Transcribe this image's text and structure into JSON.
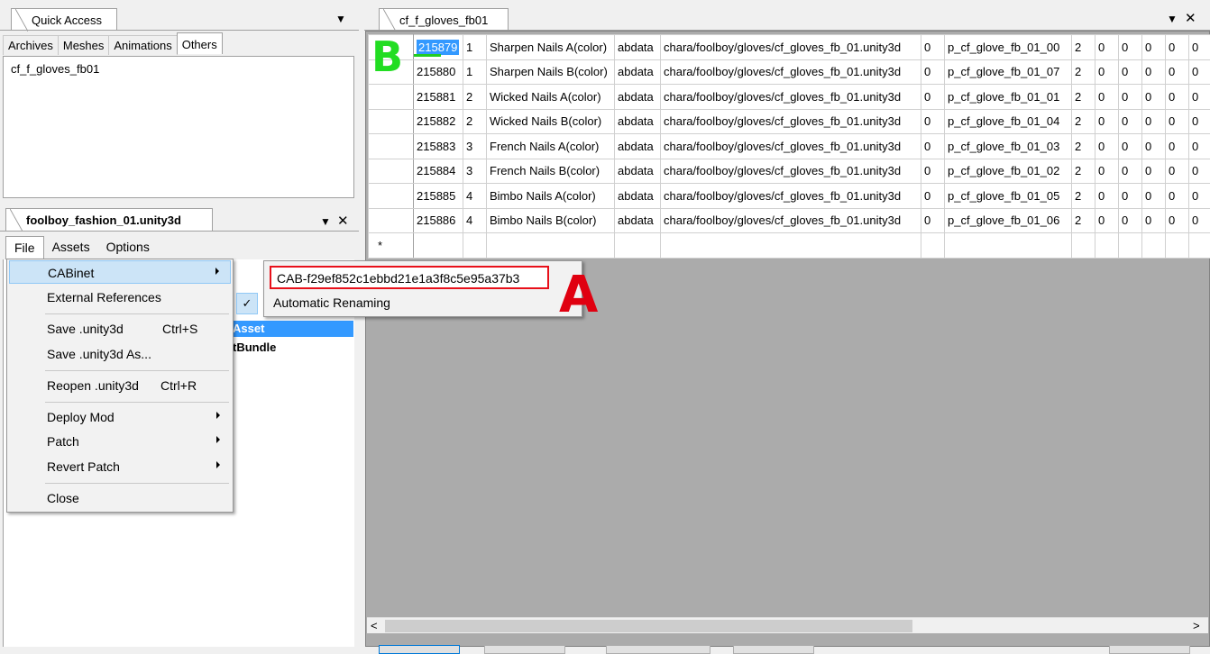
{
  "quick_access": {
    "title": "Quick Access",
    "tabs": [
      "Archives",
      "Meshes",
      "Animations",
      "Others"
    ],
    "active_tab": "Others",
    "items": [
      "cf_f_gloves_fb01"
    ]
  },
  "unity_panel": {
    "title": "foolboy_fashion_01.unity3d",
    "menubar": [
      "File",
      "Assets",
      "Options"
    ],
    "tree_items": [
      "Asset",
      "tBundle"
    ]
  },
  "file_menu": {
    "items": [
      {
        "label": "CABinet",
        "shortcut": "",
        "submenu": true
      },
      {
        "label": "External References",
        "shortcut": "",
        "submenu": false
      },
      {
        "label": "Save .unity3d",
        "shortcut": "Ctrl+S",
        "submenu": false
      },
      {
        "label": "Save .unity3d As...",
        "shortcut": "",
        "submenu": false
      },
      {
        "label": "Reopen .unity3d",
        "shortcut": "Ctrl+R",
        "submenu": false
      },
      {
        "label": "Deploy Mod",
        "shortcut": "",
        "submenu": true
      },
      {
        "label": "Patch",
        "shortcut": "",
        "submenu": true
      },
      {
        "label": "Revert Patch",
        "shortcut": "",
        "submenu": true
      },
      {
        "label": "Close",
        "shortcut": "",
        "submenu": false
      }
    ]
  },
  "cabinet_menu": {
    "cab_name": "CAB-f29ef852c1ebbd21e1a3f8c5e95a37b3",
    "auto_rename_label": "Automatic Renaming",
    "auto_rename_checked": "✓"
  },
  "annotations": {
    "a": "A",
    "b": "B"
  },
  "grid": {
    "tab_title": "cf_f_gloves_fb01",
    "new_row_marker": "*",
    "rows": [
      [
        "215879",
        "1",
        "Sharpen Nails A(color)",
        "abdata",
        "chara/foolboy/gloves/cf_gloves_fb_01.unity3d",
        "0",
        "p_cf_glove_fb_01_00",
        "2",
        "0",
        "0",
        "0",
        "0",
        "0"
      ],
      [
        "215880",
        "1",
        "Sharpen Nails B(color)",
        "abdata",
        "chara/foolboy/gloves/cf_gloves_fb_01.unity3d",
        "0",
        "p_cf_glove_fb_01_07",
        "2",
        "0",
        "0",
        "0",
        "0",
        "0"
      ],
      [
        "215881",
        "2",
        "Wicked Nails A(color)",
        "abdata",
        "chara/foolboy/gloves/cf_gloves_fb_01.unity3d",
        "0",
        "p_cf_glove_fb_01_01",
        "2",
        "0",
        "0",
        "0",
        "0",
        "0"
      ],
      [
        "215882",
        "2",
        "Wicked Nails B(color)",
        "abdata",
        "chara/foolboy/gloves/cf_gloves_fb_01.unity3d",
        "0",
        "p_cf_glove_fb_01_04",
        "2",
        "0",
        "0",
        "0",
        "0",
        "0"
      ],
      [
        "215883",
        "3",
        "French Nails A(color)",
        "abdata",
        "chara/foolboy/gloves/cf_gloves_fb_01.unity3d",
        "0",
        "p_cf_glove_fb_01_03",
        "2",
        "0",
        "0",
        "0",
        "0",
        "0"
      ],
      [
        "215884",
        "3",
        "French Nails B(color)",
        "abdata",
        "chara/foolboy/gloves/cf_gloves_fb_01.unity3d",
        "0",
        "p_cf_glove_fb_01_02",
        "2",
        "0",
        "0",
        "0",
        "0",
        "0"
      ],
      [
        "215885",
        "4",
        "Bimbo Nails A(color)",
        "abdata",
        "chara/foolboy/gloves/cf_gloves_fb_01.unity3d",
        "0",
        "p_cf_glove_fb_01_05",
        "2",
        "0",
        "0",
        "0",
        "0",
        "0"
      ],
      [
        "215886",
        "4",
        "Bimbo Nails B(color)",
        "abdata",
        "chara/foolboy/gloves/cf_gloves_fb_01.unity3d",
        "0",
        "p_cf_glove_fb_01_06",
        "2",
        "0",
        "0",
        "0",
        "0",
        "0"
      ]
    ]
  },
  "icons": {
    "dropdown": "chevron-down-icon",
    "close": "close-icon",
    "submenu": "chevron-right-icon",
    "scroll_left": "chevron-left-icon",
    "scroll_right": "chevron-right-icon"
  },
  "colors": {
    "selection": "#3399ff",
    "menu_highlight": "#cce4f7",
    "annotation_a": "#e00010",
    "annotation_b": "#22dd22"
  }
}
